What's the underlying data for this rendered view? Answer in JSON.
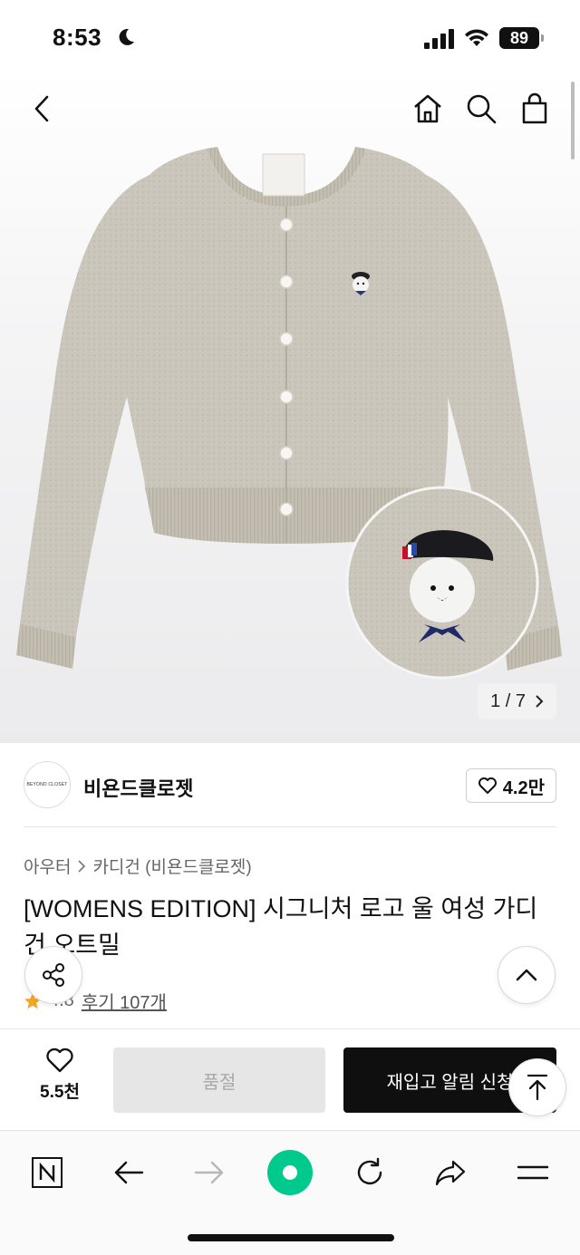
{
  "status_bar": {
    "time": "8:53",
    "battery": "89"
  },
  "product_image": {
    "page_current": "1",
    "page_total": "7",
    "page_label": "1 / 7"
  },
  "brand": {
    "logo_text": "BEYOND CLOSET",
    "name": "비욘드클로젯",
    "likes": "4.2만"
  },
  "breadcrumb": {
    "category": "아우터",
    "subcategory": "카디건 (비욘드클로젯)"
  },
  "product": {
    "title": "[WOMENS EDITION] 시그니처 로고 울 여성 가디건 오트밀",
    "rating": "4.8",
    "reviews": "후기 107개"
  },
  "action_bar": {
    "wish_count": "5.5천",
    "soldout_label": "품절",
    "restock_label": "재입고 알림 신청"
  },
  "colors": {
    "accent": "#0f0f0f",
    "browser_green": "#00c98d",
    "rating_star": "#f5a623"
  },
  "icons": [
    "back-icon",
    "home-icon",
    "search-icon",
    "bag-icon",
    "share-icon",
    "chevron-up-icon",
    "heart-icon",
    "scroll-top-icon",
    "naver-icon",
    "forward-icon",
    "reload-icon",
    "menu-icon"
  ]
}
